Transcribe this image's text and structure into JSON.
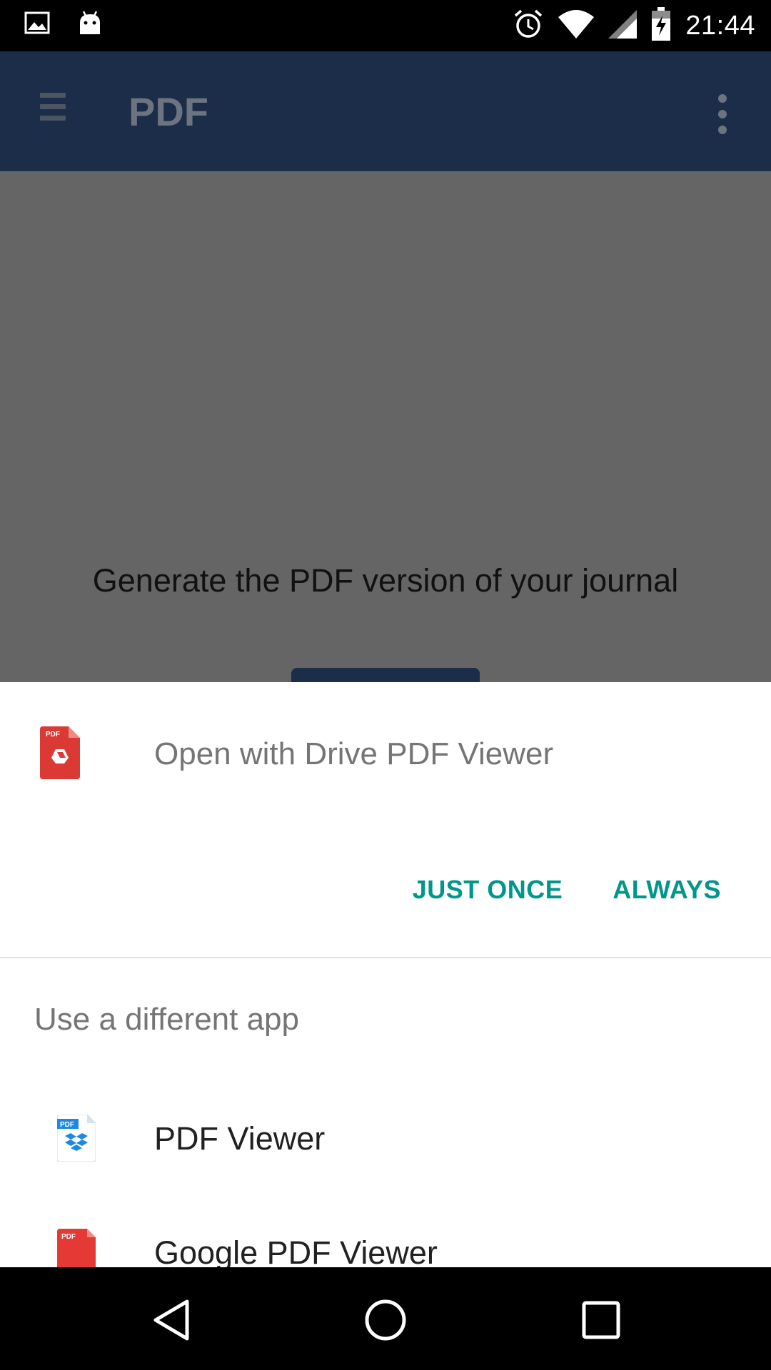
{
  "status_bar": {
    "time": "21:44",
    "icons": [
      "image-icon",
      "android-icon",
      "alarm-icon",
      "wifi-icon",
      "signal-icon",
      "battery-charging-icon"
    ]
  },
  "app_bar": {
    "title": "PDF",
    "icons": [
      "menu-icon",
      "more-vert-icon"
    ]
  },
  "content": {
    "message": "Generate the PDF version of your journal"
  },
  "chooser": {
    "open_with_label": "Open with Drive PDF Viewer",
    "just_once_label": "JUST ONCE",
    "always_label": "ALWAYS",
    "different_app_label": "Use a different app",
    "apps": [
      {
        "label": "PDF Viewer",
        "icon": "dropbox-pdf-icon"
      },
      {
        "label": "Google PDF Viewer",
        "icon": "google-pdf-icon"
      }
    ],
    "icon_badge": "PDF",
    "accent_color": "#00968a"
  },
  "nav_bar": {
    "icons": [
      "back-icon",
      "home-icon",
      "recents-icon"
    ]
  }
}
